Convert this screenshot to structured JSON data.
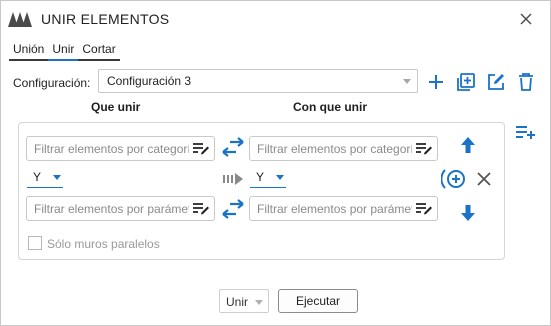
{
  "window": {
    "title": "UNIR ELEMENTOS",
    "icons": {
      "app": "app-logo-icon",
      "close": "close-icon"
    }
  },
  "tabs": [
    {
      "label": "Unión",
      "active": false
    },
    {
      "label": "Unir",
      "active": true
    },
    {
      "label": "Cortar",
      "active": false
    }
  ],
  "config": {
    "label": "Configuración:",
    "selected": "Configuración 3",
    "tools": [
      "add-icon",
      "duplicate-icon",
      "edit-icon",
      "delete-icon"
    ]
  },
  "columns": {
    "left_header": "Que unir",
    "right_header": "Con que unir"
  },
  "rows": {
    "left_category_placeholder": "Filtrar elementos por categoría",
    "right_category_placeholder": "Filtrar elementos por categoría",
    "left_operator": "Y",
    "right_operator": "Y",
    "left_parameter_placeholder": "Filtrar elementos por parámetro",
    "right_parameter_placeholder": "Filtrar elementos por parámetro"
  },
  "options": {
    "parallel_walls_label": "Sólo muros paralelos",
    "parallel_walls_checked": false
  },
  "footer": {
    "mode": "Unir",
    "execute": "Ejecutar"
  },
  "colors": {
    "accent": "#1a73c7",
    "panel_border": "#d6d6d6",
    "disabled_text": "#9a9a9a"
  }
}
